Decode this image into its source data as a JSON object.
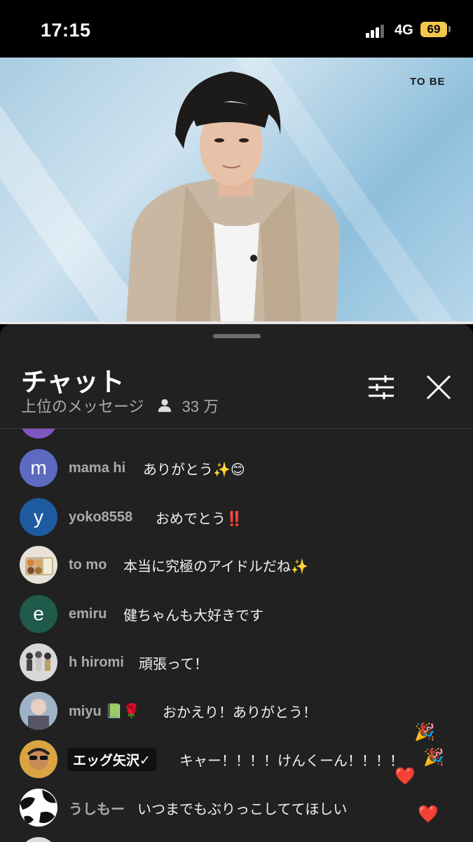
{
  "status_bar": {
    "time": "17:15",
    "network": "4G",
    "battery": "69"
  },
  "video": {
    "watermark": "TO BE",
    "progress_percent": 100
  },
  "chat": {
    "title": "チャット",
    "mode": "上位のメッセージ",
    "viewers": "33 万",
    "messages": [
      {
        "avatar_letter": "m",
        "avatar_color": "#5c6bc0",
        "author": "mama hi",
        "text": "ありがとう✨😊"
      },
      {
        "avatar_letter": "y",
        "avatar_color": "#1e5aa0",
        "author": "yoko8558",
        "text": "おめでとう‼️"
      },
      {
        "avatar_letter": "",
        "avatar_color": "#e8e2d8",
        "author": "to mo",
        "text": "本当に究極のアイドルだね✨"
      },
      {
        "avatar_letter": "e",
        "avatar_color": "#1f5a4a",
        "author": "emiru",
        "text": "健ちゃんも大好きです"
      },
      {
        "avatar_letter": "",
        "avatar_color": "#d8d8d8",
        "author": "h hiromi",
        "text": "頑張って！"
      },
      {
        "avatar_letter": "",
        "avatar_color": "#b9b9b9",
        "author": "miyu 📗🌹",
        "text": "おかえり！ありがとう！"
      },
      {
        "avatar_letter": "",
        "avatar_color": "#d9a441",
        "author": "エッグ矢沢✓",
        "text": "キャー！！！！けんくーん！！！！"
      },
      {
        "avatar_letter": "",
        "avatar_color": "#ffffff",
        "author": "うしもー",
        "text": "いつまでもぶりっこしててほしい"
      }
    ],
    "floating_reactions": [
      "🎉",
      "🎉",
      "❤️",
      "❤️"
    ]
  }
}
